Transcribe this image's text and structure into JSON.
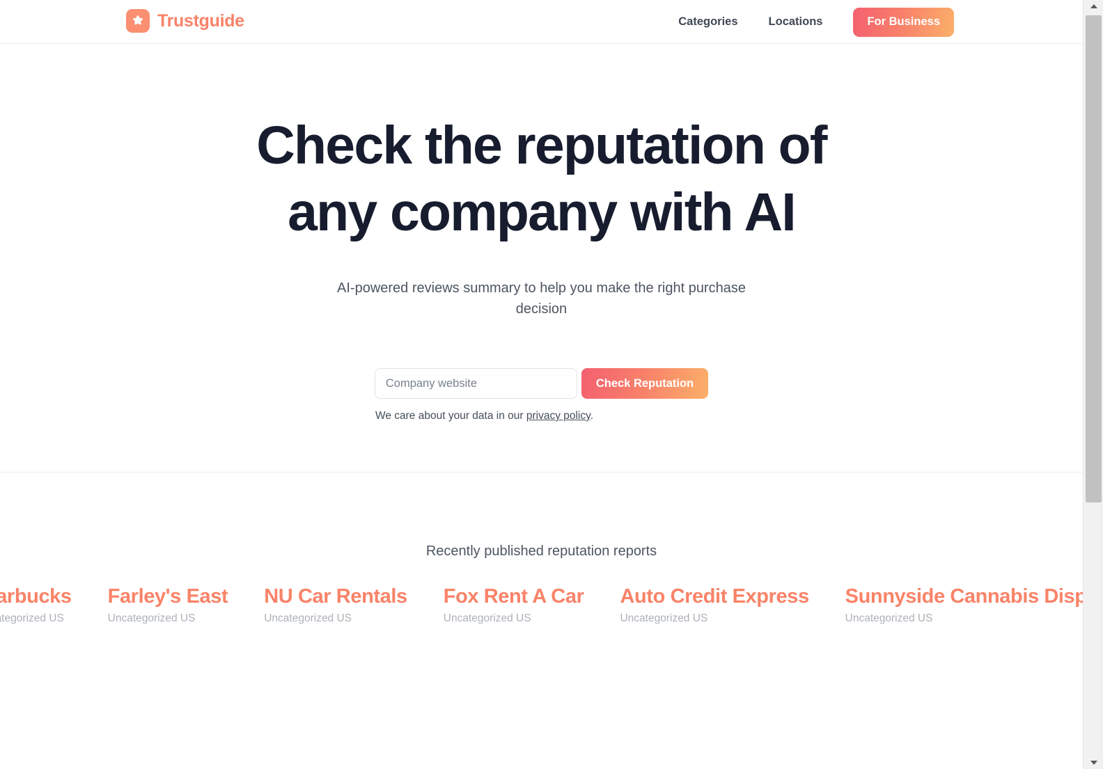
{
  "header": {
    "brand_name": "Trustguide",
    "brand_icon": "star-icon",
    "nav": [
      {
        "label": "Categories",
        "name": "nav-link-categories"
      },
      {
        "label": "Locations",
        "name": "nav-link-locations"
      }
    ],
    "cta_label": "For Business"
  },
  "hero": {
    "title_line1": "Check the reputation of",
    "title_line2": "any company with AI",
    "subtitle": "AI-powered reviews summary to help you make the right purchase decision",
    "search": {
      "placeholder": "Company website",
      "value": "",
      "button_label": "Check Reputation"
    },
    "privacy_prefix": "We care about your data in our ",
    "privacy_link": "privacy policy",
    "privacy_suffix": "."
  },
  "reports": {
    "title": "Recently published reputation reports",
    "items": [
      {
        "name": "Starbucks",
        "meta": "Uncategorized US"
      },
      {
        "name": "Farley's East",
        "meta": "Uncategorized US"
      },
      {
        "name": "NU Car Rentals",
        "meta": "Uncategorized US"
      },
      {
        "name": "Fox Rent A Car",
        "meta": "Uncategorized US"
      },
      {
        "name": "Auto Credit Express",
        "meta": "Uncategorized US"
      },
      {
        "name": "Sunnyside Cannabis Dispensary",
        "meta": "Uncategorized US"
      }
    ]
  },
  "colors": {
    "brand": "#f98368",
    "gradient_start": "#f4606f",
    "gradient_end": "#fbb069",
    "heading": "#171c2e",
    "body_text": "#4d5561",
    "muted_text": "#adb1b7"
  }
}
